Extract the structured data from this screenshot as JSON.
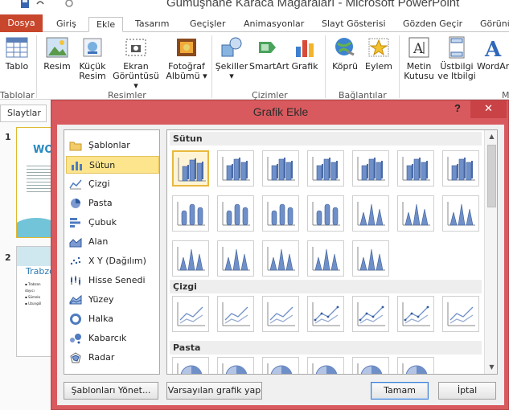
{
  "app": {
    "title": "Gümüşhane Karaca Mağaraları  -  Microsoft PowerPoint"
  },
  "ribbon_tabs": [
    {
      "label": "Dosya"
    },
    {
      "label": "Giriş"
    },
    {
      "label": "Ekle"
    },
    {
      "label": "Tasarım"
    },
    {
      "label": "Geçişler"
    },
    {
      "label": "Animasyonlar"
    },
    {
      "label": "Slayt Gösterisi"
    },
    {
      "label": "Gözden Geçir"
    },
    {
      "label": "Görünü"
    }
  ],
  "ribbon": {
    "tablo": "Tablo",
    "resim": "Resim",
    "kucuk_resim_1": "Küçük",
    "kucuk_resim_2": "Resim",
    "ekran_1": "Ekran",
    "ekran_2": "Görüntüsü ▾",
    "fotograf_1": "Fotoğraf",
    "fotograf_2": "Albümü ▾",
    "sekiller_1": "Şekiller",
    "sekiller_2": "▾",
    "smartart": "SmartArt",
    "grafik": "Grafik",
    "kopru": "Köprü",
    "eylem": "Eylem",
    "metin_1": "Metin",
    "metin_2": "Kutusu",
    "ustbilgi_1": "Üstbilgi",
    "ustbilgi_2": "ve Itbilgi",
    "wordart": "WordArt",
    "groups": {
      "tablolar": "Tablolar",
      "resimler": "Resimler",
      "cizimler": "Çizimler",
      "baglantilar": "Bağlantılar",
      "m": "M"
    }
  },
  "slides_pane": {
    "tab_label": "Slaytlar",
    "slide1_num": "1",
    "slide1_title": "WO",
    "slide2_num": "2",
    "slide2_title": "Trabzo",
    "slide2_lines": [
      "▪ Trabzon",
      "dayıcı",
      "▪ Sümela",
      "▪ Uzungöl"
    ]
  },
  "dialog": {
    "title": "Grafik Ekle",
    "help": "?",
    "close": "✕",
    "types": [
      {
        "label": "Şablonlar"
      },
      {
        "label": "Sütun"
      },
      {
        "label": "Çizgi"
      },
      {
        "label": "Pasta"
      },
      {
        "label": "Çubuk"
      },
      {
        "label": "Alan"
      },
      {
        "label": "X Y (Dağılım)"
      },
      {
        "label": "Hisse Senedi"
      },
      {
        "label": "Yüzey"
      },
      {
        "label": "Halka"
      },
      {
        "label": "Kabarcık"
      },
      {
        "label": "Radar"
      }
    ],
    "selected_type": "Sütun",
    "sections": {
      "sutun": "Sütun",
      "cizgi": "Çizgi",
      "pasta": "Pasta"
    },
    "buttons": {
      "manage_templates": "Şablonları Yönet...",
      "set_default": "Varsayılan grafik yap",
      "ok": "Tamam",
      "cancel": "İptal"
    }
  },
  "colors": {
    "file_tab": "#c8462b",
    "dialog_frame": "#d85a5e",
    "close_button": "#c94346",
    "selected_item": "#fde58e",
    "chart_blue": "#6f8fc8"
  }
}
